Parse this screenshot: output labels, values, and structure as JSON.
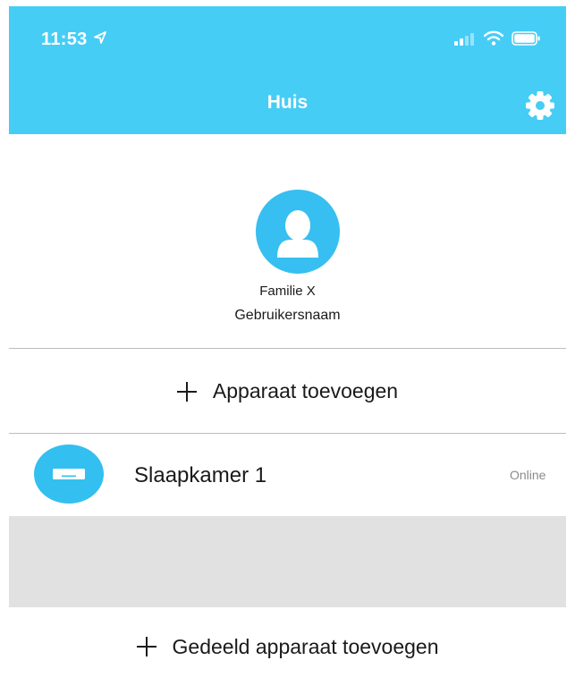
{
  "status_bar": {
    "time": "11:53",
    "icons": [
      "location-arrow-icon",
      "signal-icon",
      "wifi-icon",
      "battery-icon"
    ]
  },
  "header": {
    "title": "Huis",
    "background_color": "#45cdf6",
    "settings_icon": "gear-icon"
  },
  "profile": {
    "avatar_icon": "user-icon",
    "name": "Familie X",
    "username_label": "Gebruikersnaam"
  },
  "add_device": {
    "label": "Apparaat toevoegen",
    "icon": "plus-icon"
  },
  "devices": [
    {
      "name": "Slaapkamer 1",
      "status": "Online",
      "icon": "air-conditioner-icon"
    }
  ],
  "add_shared_device": {
    "label": "Gedeeld apparaat toevoegen",
    "icon": "plus-icon"
  }
}
